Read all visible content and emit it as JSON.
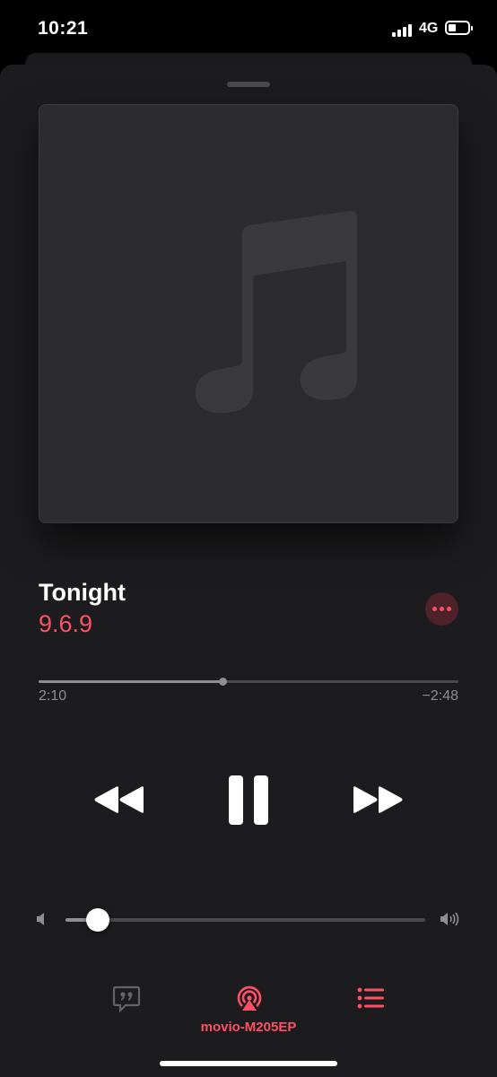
{
  "status_bar": {
    "time": "10:21",
    "network": "4G",
    "battery_level": 0.4
  },
  "now_playing": {
    "title": "Tonight",
    "artist": "9.6.9",
    "elapsed": "2:10",
    "remaining": "−2:48",
    "progress": 0.437,
    "volume": 0.09,
    "airplay_device": "movio-M205EP"
  },
  "icons": {
    "artwork": "music-note-icon",
    "more": "ellipsis-icon",
    "rewind": "rewind-icon",
    "pause": "pause-icon",
    "forward": "fast-forward-icon",
    "volume_low": "speaker-low-icon",
    "volume_high": "speaker-high-icon",
    "lyrics": "quote-bubble-icon",
    "airplay": "airplay-audio-icon",
    "queue": "list-icon"
  },
  "colors": {
    "accent": "#ff4f66",
    "background": "#1c1c1e",
    "artwork_bg": "#2c2c2e",
    "secondary_text": "#8e8e93"
  }
}
